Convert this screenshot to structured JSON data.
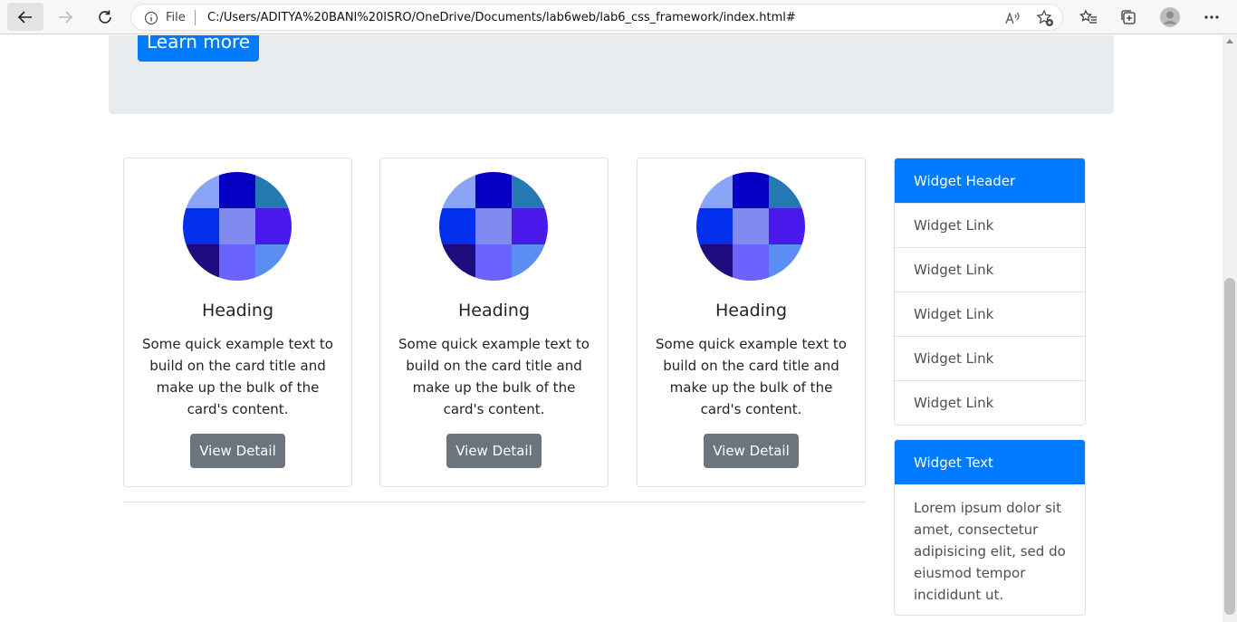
{
  "browser": {
    "address_scheme": "File",
    "url": "C:/Users/ADITYA%20BANI%20ISRO/OneDrive/Documents/lab6web/lab6_css_framework/index.html#",
    "read_aloud": "A̅"
  },
  "jumbotron": {
    "button_label": "Learn more"
  },
  "cards": [
    {
      "title": "Heading",
      "text": "Some quick example text to build on the card title and make up the bulk of the card's content.",
      "button": "View Detail"
    },
    {
      "title": "Heading",
      "text": "Some quick example text to build on the card title and make up the bulk of the card's content.",
      "button": "View Detail"
    },
    {
      "title": "Heading",
      "text": "Some quick example text to build on the card title and make up the bulk of the card's content.",
      "button": "View Detail"
    }
  ],
  "avatar_colors": [
    "#8aa5f7",
    "#0400c4",
    "#2479b3",
    "#0330ec",
    "#8089ee",
    "#4a1aed",
    "#1e0b7d",
    "#6a64fd",
    "#5b8ef2"
  ],
  "widgets": {
    "links": {
      "header": "Widget Header",
      "items": [
        "Widget Link",
        "Widget Link",
        "Widget Link",
        "Widget Link",
        "Widget Link"
      ]
    },
    "text": {
      "header": "Widget Text",
      "body": "Lorem ipsum dolor sit amet, consectetur adipisicing elit, sed do eiusmod tempor incididunt ut."
    }
  },
  "colors": {
    "primary": "#007bff",
    "secondary": "#6c757d",
    "jumbotron": "#e9ecef"
  }
}
